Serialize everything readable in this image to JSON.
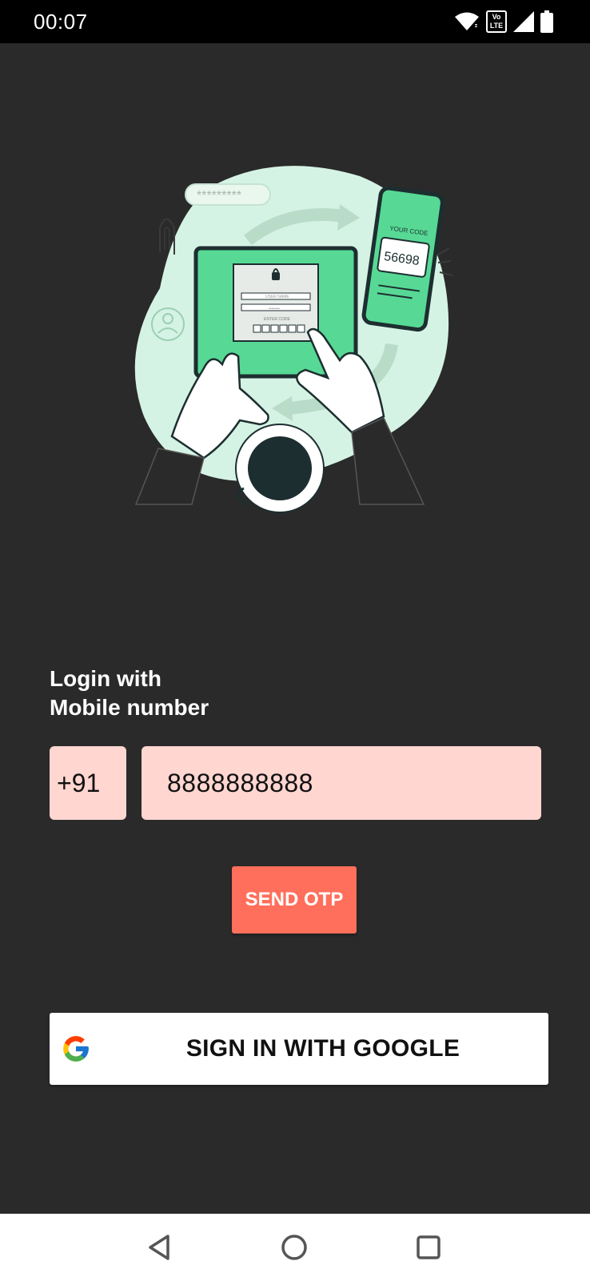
{
  "status_bar": {
    "time": "00:07",
    "icons": [
      "wifi-icon",
      "volte-icon",
      "signal-icon",
      "battery-icon"
    ],
    "volte_top": "Vo",
    "volte_bottom": "LTE"
  },
  "hero": {
    "password_mask": "*********",
    "phone_caption": "YOUR CODE",
    "phone_code": "56698",
    "tablet_username": "USER NAME",
    "tablet_password": "••••••••",
    "tablet_code_label": "ENTER CODE",
    "colors": {
      "blob": "#d5f3e4",
      "green": "#57d995",
      "dark": "#1d2e30"
    }
  },
  "login": {
    "heading_line1": "Login with",
    "heading_line2": "Mobile number",
    "country_code": "+91",
    "phone_value": "8888888888",
    "send_otp_label": "SEND OTP"
  },
  "google": {
    "label": "SIGN IN WITH GOOGLE",
    "icon": "google-g-icon"
  },
  "nav": {
    "icons": [
      "back-icon",
      "home-icon",
      "recents-icon"
    ]
  },
  "colors": {
    "background": "#2a2a2a",
    "input_bg": "#ffd6d0",
    "accent": "#ff6f5b"
  }
}
